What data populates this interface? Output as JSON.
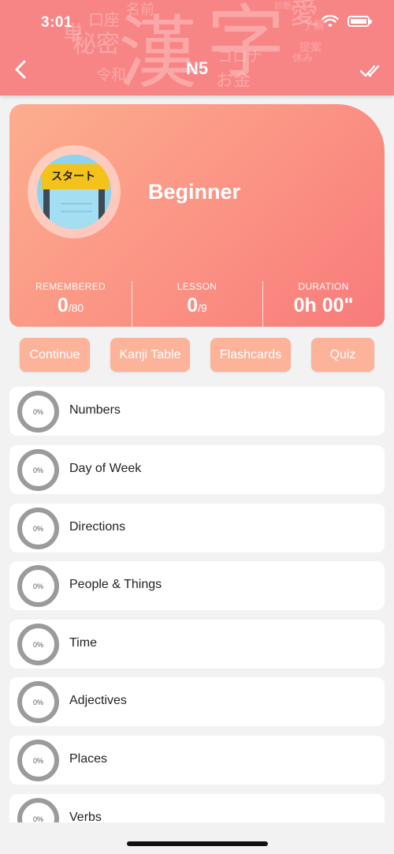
{
  "status_bar": {
    "time": "3:01"
  },
  "header": {
    "title": "N5",
    "background_words": [
      "漢",
      "字",
      "口座",
      "名前",
      "診断",
      "愛",
      "了解",
      "提案",
      "休み",
      "コロナ",
      "お金",
      "令和",
      "秘密",
      "単"
    ]
  },
  "hero": {
    "badge_text": "スタート",
    "level": "Beginner",
    "stats": {
      "remembered": {
        "label": "REMEMBERED",
        "value": "0",
        "total": "/80"
      },
      "lesson": {
        "label": "LESSON",
        "value": "0",
        "total": "/9"
      },
      "duration": {
        "label": "DURATION",
        "value": "0h 00\""
      }
    }
  },
  "actions": {
    "continue": "Continue",
    "kanji_table": "Kanji Table",
    "flashcards": "Flashcards",
    "quiz": "Quiz"
  },
  "lessons": [
    {
      "label": "Numbers",
      "progress": "0%"
    },
    {
      "label": "Day of Week",
      "progress": "0%"
    },
    {
      "label": "Directions",
      "progress": "0%"
    },
    {
      "label": "People & Things",
      "progress": "0%"
    },
    {
      "label": "Time",
      "progress": "0%"
    },
    {
      "label": "Adjectives",
      "progress": "0%"
    },
    {
      "label": "Places",
      "progress": "0%"
    },
    {
      "label": "Verbs",
      "progress": "0%"
    }
  ],
  "colors": {
    "header": "#f88585",
    "hero_start": "#fcae8e",
    "hero_end": "#f87b7b",
    "button": "#fcb39a",
    "ring": "#9b9b9b"
  }
}
